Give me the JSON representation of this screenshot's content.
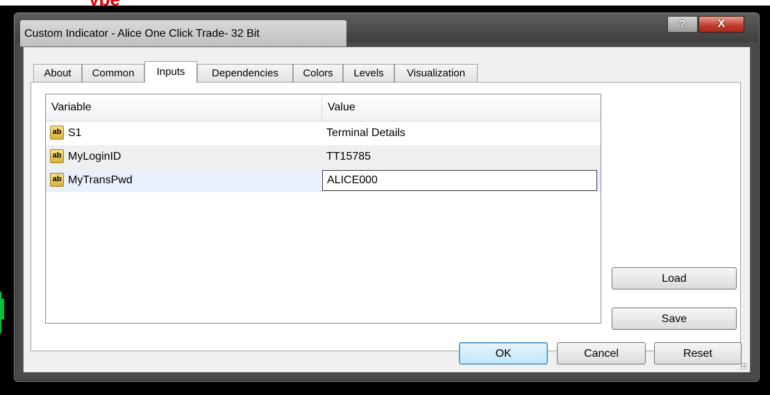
{
  "background_caption": "ype",
  "window": {
    "title": "Custom Indicator - Alice One Click Trade- 32 Bit",
    "help_label": "?",
    "close_label": "X"
  },
  "tabs": [
    {
      "label": "About",
      "active": false
    },
    {
      "label": "Common",
      "active": false
    },
    {
      "label": "Inputs",
      "active": true
    },
    {
      "label": "Dependencies",
      "active": false
    },
    {
      "label": "Colors",
      "active": false
    },
    {
      "label": "Levels",
      "active": false
    },
    {
      "label": "Visualization",
      "active": false
    }
  ],
  "grid": {
    "headers": {
      "variable": "Variable",
      "value": "Value"
    },
    "type_icon": "ab",
    "rows": [
      {
        "variable": "S1",
        "value": "Terminal Details"
      },
      {
        "variable": "MyLoginID",
        "value": "TT15785"
      },
      {
        "variable": "MyTransPwd",
        "value": "ALICE000"
      }
    ]
  },
  "buttons": {
    "load": "Load",
    "save": "Save",
    "ok": "OK",
    "cancel": "Cancel",
    "reset": "Reset"
  },
  "colors": {
    "accent_red": "#e00000",
    "chart_green": "#00c040",
    "close_red": "#c0392b"
  },
  "icons": [
    "help-icon",
    "close-icon",
    "ab-type-icon",
    "resize-grip-icon"
  ]
}
